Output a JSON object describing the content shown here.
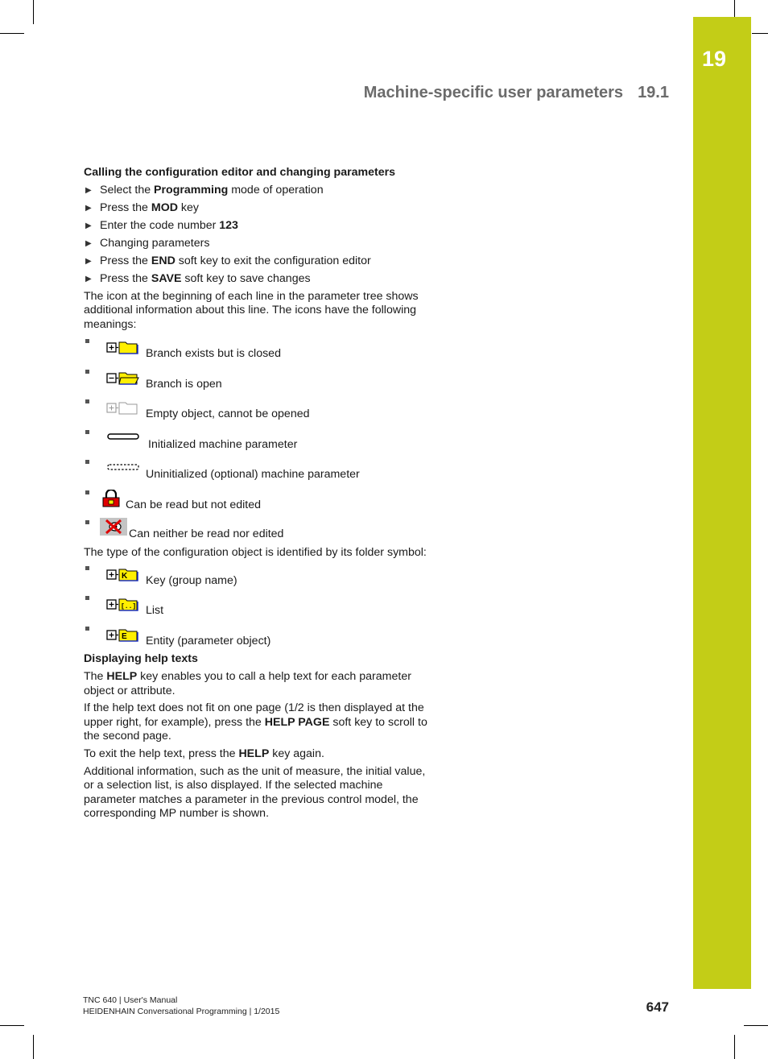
{
  "chapter": {
    "number": "19",
    "accent_color": "#c3cd17"
  },
  "running_header": {
    "title": "Machine-specific user parameters",
    "section": "19.1"
  },
  "section1": {
    "heading": "Calling the configuration editor and changing parameters",
    "steps": [
      {
        "pre": "Select the ",
        "bold": "Programming",
        "post": " mode of operation"
      },
      {
        "pre": "Press the ",
        "bold": "MOD",
        "post": " key"
      },
      {
        "pre": "Enter the code number ",
        "bold": "123",
        "post": ""
      },
      {
        "pre": "Changing parameters",
        "bold": "",
        "post": ""
      },
      {
        "pre": "Press the ",
        "bold": "END",
        "post": " soft key to exit the configuration editor"
      },
      {
        "pre": "Press the ",
        "bold": "SAVE",
        "post": " soft key to save changes"
      }
    ],
    "intro": "The icon at the beginning of each line in the parameter tree shows additional information about this line. The icons have the following meanings:",
    "icons": [
      {
        "icon": "branch-closed-folder-icon",
        "label": "Branch exists but is closed"
      },
      {
        "icon": "branch-open-folder-icon",
        "label": "Branch is open"
      },
      {
        "icon": "empty-object-folder-icon",
        "label": "Empty object, cannot be opened"
      },
      {
        "icon": "initialized-parameter-icon",
        "label": "Initialized machine parameter"
      },
      {
        "icon": "uninitialized-parameter-icon",
        "label": "Uninitialized (optional) machine parameter"
      },
      {
        "icon": "lock-icon",
        "label": "Can be read but not edited"
      },
      {
        "icon": "no-access-eye-icon",
        "label": "Can neither be read nor edited"
      }
    ],
    "type_intro": "The type of the configuration object is identified by its folder symbol:",
    "types": [
      {
        "icon": "key-folder-icon",
        "glyph": "K",
        "label": "Key (group name)"
      },
      {
        "icon": "list-folder-icon",
        "glyph": "[..]",
        "label": "List"
      },
      {
        "icon": "entity-folder-icon",
        "glyph": "E",
        "label": "Entity (parameter object)"
      }
    ]
  },
  "section2": {
    "heading": "Displaying help texts",
    "p1": {
      "pre": "The ",
      "bold": "HELP",
      "post": " key enables you to call a help text for each parameter object or attribute."
    },
    "p2": {
      "pre": "If the help text does not fit on one page (1/2 is then displayed at the upper right, for example), press the ",
      "bold": "HELP PAGE",
      "post": " soft key to scroll to the second page."
    },
    "p3": {
      "pre": "To exit the help text, press the ",
      "bold": "HELP",
      "post": " key again."
    },
    "p4": "Additional information, such as the unit of measure, the initial value, or a selection list, is also displayed. If the selected machine parameter matches a parameter in the previous control model, the corresponding MP number is shown."
  },
  "footer": {
    "line1": "TNC 640 | User's Manual",
    "line2": "HEIDENHAIN Conversational Programming | 1/2015",
    "page": "647"
  }
}
